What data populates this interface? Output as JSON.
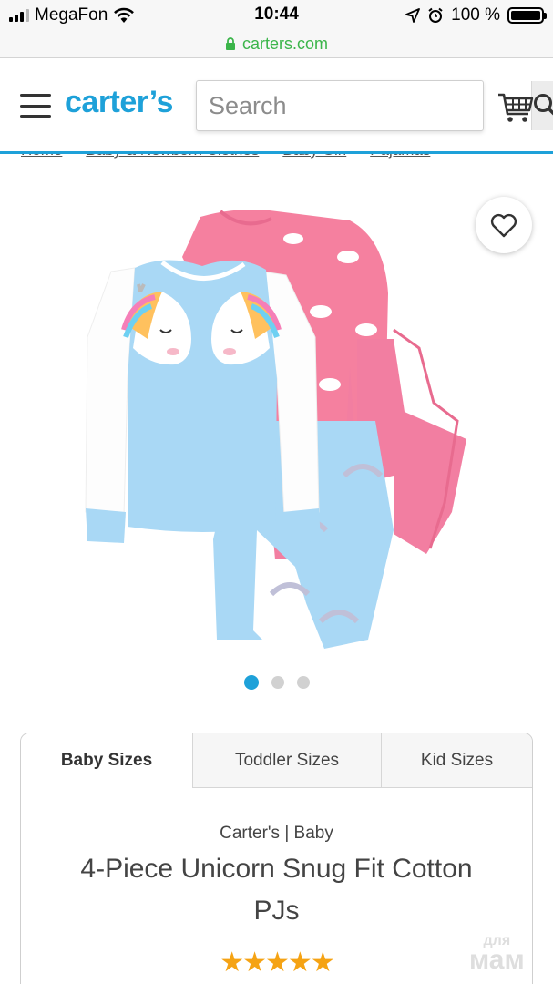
{
  "status_bar": {
    "carrier": "MegaFon",
    "time": "10:44",
    "battery": "100 %",
    "battery_level": 1.0
  },
  "browser": {
    "url": "carters.com"
  },
  "header": {
    "logo": "carter’s",
    "search_placeholder": "Search"
  },
  "breadcrumb": [
    "Home",
    "Baby & Newborn Clothes",
    "Baby Girl",
    "Pajamas"
  ],
  "gallery": {
    "image_count": 3,
    "active_index": 0
  },
  "size_tabs": [
    {
      "label": "Baby Sizes",
      "active": true
    },
    {
      "label": "Toddler Sizes",
      "active": false
    },
    {
      "label": "Kid Sizes",
      "active": false
    }
  ],
  "product": {
    "brand": "Carter's | Baby",
    "title": "4-Piece Unicorn Snug Fit Cotton PJs",
    "rating": 5,
    "rating_max": 5,
    "stars": "★★★★★"
  },
  "watermark": {
    "top": "для",
    "bottom": "мам"
  },
  "colors": {
    "brand_blue": "#1ea1d9",
    "lock_green": "#3bb54a",
    "star": "#f5a314"
  }
}
